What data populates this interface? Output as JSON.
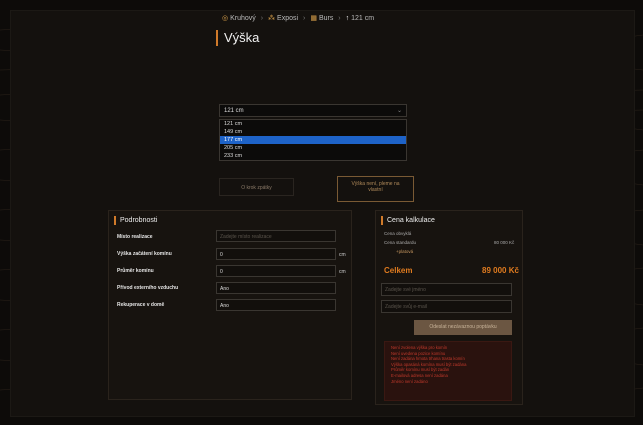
{
  "breadcrumb": [
    {
      "label": "Kruhový",
      "icon": "circle-icon"
    },
    {
      "label": "Exposi",
      "icon": "nodes-icon"
    },
    {
      "label": "Burs",
      "icon": "grid-icon"
    },
    {
      "label": "121 cm",
      "icon": "arrow-up-icon"
    }
  ],
  "page_title": "Výška",
  "height_select": {
    "value": "121 cm",
    "options": [
      "121 cm",
      "149 cm",
      "177 cm",
      "205 cm",
      "233 cm"
    ],
    "highlighted_index": 2
  },
  "buttons": {
    "back": "O krok zpátky",
    "select_height": "Výška není, pleme na vlastní"
  },
  "details": {
    "title": "Podrobnosti",
    "rows": [
      {
        "label": "Místo realizace",
        "value": "",
        "placeholder": "Zadejte místo realizace",
        "unit": ""
      },
      {
        "label": "Výška začátení komínu",
        "value": "0",
        "placeholder": "",
        "unit": "cm"
      },
      {
        "label": "Průměr komínu",
        "value": "0",
        "placeholder": "",
        "unit": "cm"
      },
      {
        "label": "Přívod externího vzduchu",
        "value": "Ano",
        "placeholder": "",
        "unit": ""
      },
      {
        "label": "Rekuperace v domě",
        "value": "Ano",
        "placeholder": "",
        "unit": ""
      }
    ]
  },
  "price": {
    "title": "Cena kalkulace",
    "base_label": "Cena obvyklá",
    "standard_label": "Cena standardu",
    "standard_value": "80 000 Kč",
    "plus_label": "+platová",
    "total_label": "Celkem",
    "total_value": "89 000 Kč",
    "email_placeholder": "Zadejte své jméno",
    "phone_placeholder": "Zadejte svůj e-mail",
    "cta": "Odeslat nezávaznou poptávku",
    "errors": [
      "Není zvolena výška pro komín",
      "Není uvedena pozice komínu",
      "Není zadána hmota trhana trasta komín",
      "Výška opasáná komína musí být zadána",
      "Průměr komínu musí být zadán",
      "E-mailová adresa není zadána",
      "Jméno není zadáno"
    ]
  }
}
